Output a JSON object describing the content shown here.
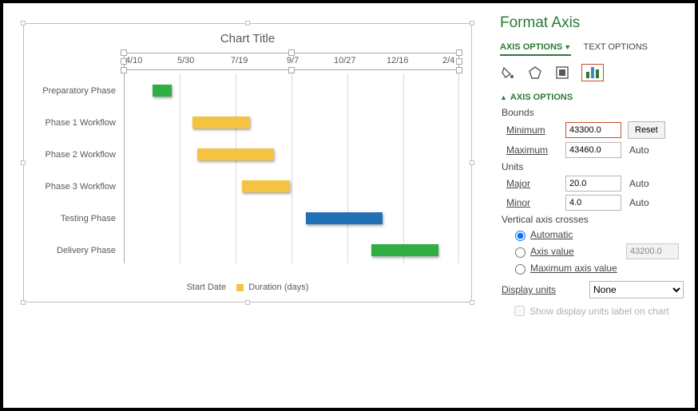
{
  "chart_data": {
    "type": "bar",
    "orientation": "horizontal-stacked-gantt",
    "title": "Chart Title",
    "x_ticks": [
      "4/10",
      "5/30",
      "7/19",
      "9/7",
      "10/27",
      "12/16",
      "2/4"
    ],
    "xlim_serial": [
      43300,
      43460
    ],
    "categories": [
      "Preparatory Phase",
      "Phase 1 Workflow",
      "Phase 2 Workflow",
      "Phase 3 Workflow",
      "Testing Phase",
      "Delivery Phase"
    ],
    "series": [
      {
        "name": "Start Date (hidden offset)",
        "values_serial": [
          43300,
          43320,
          43322,
          43350,
          43390,
          43420
        ],
        "visible": false
      },
      {
        "name": "Duration (days)",
        "values": [
          10,
          30,
          40,
          25,
          40,
          35
        ],
        "colors": [
          "#30ad43",
          "#f5c342",
          "#f5c342",
          "#f5c342",
          "#2171b5",
          "#30ad43"
        ]
      }
    ],
    "legend": [
      "Start Date",
      "Duration (days)"
    ]
  },
  "panel": {
    "title": "Format Axis",
    "tabs": {
      "axis_options": "AXIS OPTIONS",
      "text_options": "TEXT OPTIONS"
    },
    "section": "AXIS OPTIONS",
    "bounds_label": "Bounds",
    "minimum_label": "Minimum",
    "minimum_value": "43300.0",
    "reset_label": "Reset",
    "maximum_label": "Maximum",
    "maximum_value": "43460.0",
    "auto_label": "Auto",
    "units_label": "Units",
    "major_label": "Major",
    "major_value": "20.0",
    "minor_label": "Minor",
    "minor_value": "4.0",
    "vac_label": "Vertical axis crosses",
    "vac_automatic": "Automatic",
    "vac_axis_value": "Axis value",
    "vac_axis_value_val": "43200.0",
    "vac_max": "Maximum axis value",
    "display_units_label": "Display units",
    "display_units_value": "None",
    "show_du_label": "Show display units label on chart"
  }
}
